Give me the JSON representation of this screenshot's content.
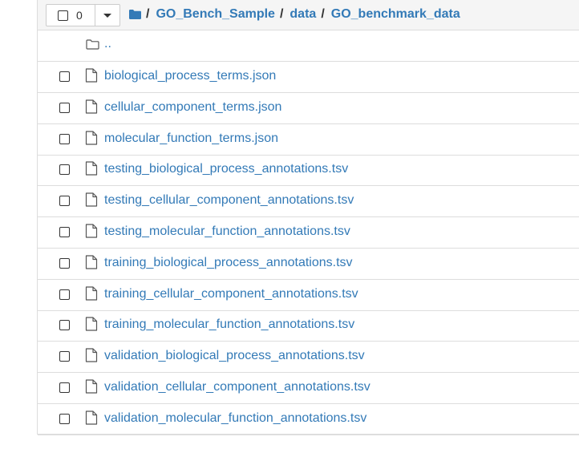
{
  "header": {
    "selected_count": "0",
    "breadcrumb": [
      "GO_Bench_Sample",
      "data",
      "GO_benchmark_data"
    ],
    "separator": "/",
    "folder_icon": "folder-icon",
    "link_color": "#337ab7"
  },
  "parent_dir": {
    "label": "..",
    "icon": "folder-outline-icon"
  },
  "files": [
    {
      "name": "biological_process_terms.json",
      "icon": "file-icon"
    },
    {
      "name": "cellular_component_terms.json",
      "icon": "file-icon"
    },
    {
      "name": "molecular_function_terms.json",
      "icon": "file-icon"
    },
    {
      "name": "testing_biological_process_annotations.tsv",
      "icon": "file-icon"
    },
    {
      "name": "testing_cellular_component_annotations.tsv",
      "icon": "file-icon"
    },
    {
      "name": "testing_molecular_function_annotations.tsv",
      "icon": "file-icon"
    },
    {
      "name": "training_biological_process_annotations.tsv",
      "icon": "file-icon"
    },
    {
      "name": "training_cellular_component_annotations.tsv",
      "icon": "file-icon"
    },
    {
      "name": "training_molecular_function_annotations.tsv",
      "icon": "file-icon"
    },
    {
      "name": "validation_biological_process_annotations.tsv",
      "icon": "file-icon"
    },
    {
      "name": "validation_cellular_component_annotations.tsv",
      "icon": "file-icon"
    },
    {
      "name": "validation_molecular_function_annotations.tsv",
      "icon": "file-icon"
    }
  ]
}
